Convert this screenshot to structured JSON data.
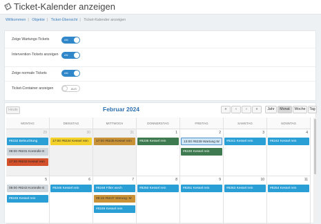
{
  "page": {
    "title": "Ticket-Kalender anzeigen",
    "icon": "ticket-icon"
  },
  "breadcrumb": [
    "Willkommen",
    "Objekte",
    "Ticket-Übersicht",
    "Ticket-Kalender anzeigen"
  ],
  "settings": [
    {
      "label": "Zeige Wartungs-Tickets",
      "state": "AN",
      "on": true
    },
    {
      "label": "Intervention-Tickets anzeigen",
      "state": "AN",
      "on": true
    },
    {
      "label": "Zeige normale Tickets",
      "state": "AN",
      "on": true
    },
    {
      "label": "Ticket-Container anzeigen",
      "state": "AUS",
      "on": false
    }
  ],
  "toolbar": {
    "today": "Heute",
    "month": "Februar 2024",
    "nav": [
      "«",
      "‹",
      "›",
      "»"
    ],
    "views": [
      "Jahr",
      "Monat",
      "Woche",
      "Tag"
    ],
    "active_view": "Monat"
  },
  "weekdays": [
    "MONTAG",
    "DIENSTAG",
    "MITTWOCH",
    "DONNERSTAG",
    "FREITAG",
    "SAMSTAG",
    "SONNTAG"
  ],
  "weeks": [
    {
      "days": [
        {
          "num": "29",
          "other": true,
          "events": [
            {
              "text": "#8232 Beleuchtung",
              "color": "blue"
            },
            {
              "text": "08:00 #8231 Kontrolle E",
              "color": "grey"
            },
            {
              "text": "17:00 #8233 Kessel rein",
              "color": "red"
            }
          ]
        },
        {
          "num": "30",
          "other": true,
          "events": [
            {
              "text": "17:00 #8234 Kessel rein",
              "color": "yellow"
            }
          ]
        },
        {
          "num": "31",
          "other": true,
          "events": [
            {
              "text": "17:00 #8235 Kessel rein",
              "color": "orange"
            }
          ]
        },
        {
          "num": "1",
          "other": false,
          "events": [
            {
              "text": "#8236 Kessel rein",
              "color": "green"
            }
          ]
        },
        {
          "num": "2",
          "other": false,
          "events": [
            {
              "text": "13:00 #8239 Wartung W",
              "color": "lightblue"
            },
            {
              "text": "#8240 Kessel rein",
              "color": "green"
            }
          ]
        },
        {
          "num": "3",
          "other": false,
          "events": [
            {
              "text": "#8241 Kessel rein",
              "color": "blue"
            }
          ]
        },
        {
          "num": "4",
          "other": false,
          "events": [
            {
              "text": "#8242 Kessel rein",
              "color": "blue"
            }
          ]
        }
      ]
    },
    {
      "days": [
        {
          "num": "5",
          "other": false,
          "events": [
            {
              "text": "08:00 #8243 Kontrolle E",
              "color": "grey"
            },
            {
              "text": "#8245 Kessel rein",
              "color": "blue"
            }
          ]
        },
        {
          "num": "6",
          "other": false,
          "events": [
            {
              "text": "#8246 Kessel rein",
              "color": "blue"
            }
          ]
        },
        {
          "num": "7",
          "other": false,
          "events": [
            {
              "text": "#8248 Filter wech",
              "color": "blue"
            },
            {
              "text": "09:15 #8247 Störung: M",
              "color": "orange"
            },
            {
              "text": "#8249 Kessel rein",
              "color": "blue"
            }
          ]
        },
        {
          "num": "8",
          "other": false,
          "events": [
            {
              "text": "#8250 Kessel rein",
              "color": "blue"
            }
          ]
        },
        {
          "num": "9",
          "other": false,
          "events": [
            {
              "text": "#8251 Kessel rein",
              "color": "blue"
            }
          ]
        },
        {
          "num": "10",
          "other": false,
          "events": [
            {
              "text": "#8253 Kessel rein",
              "color": "blue"
            }
          ]
        },
        {
          "num": "11",
          "other": false,
          "events": [
            {
              "text": "#8254 Kessel rein",
              "color": "blue"
            }
          ]
        }
      ]
    }
  ]
}
